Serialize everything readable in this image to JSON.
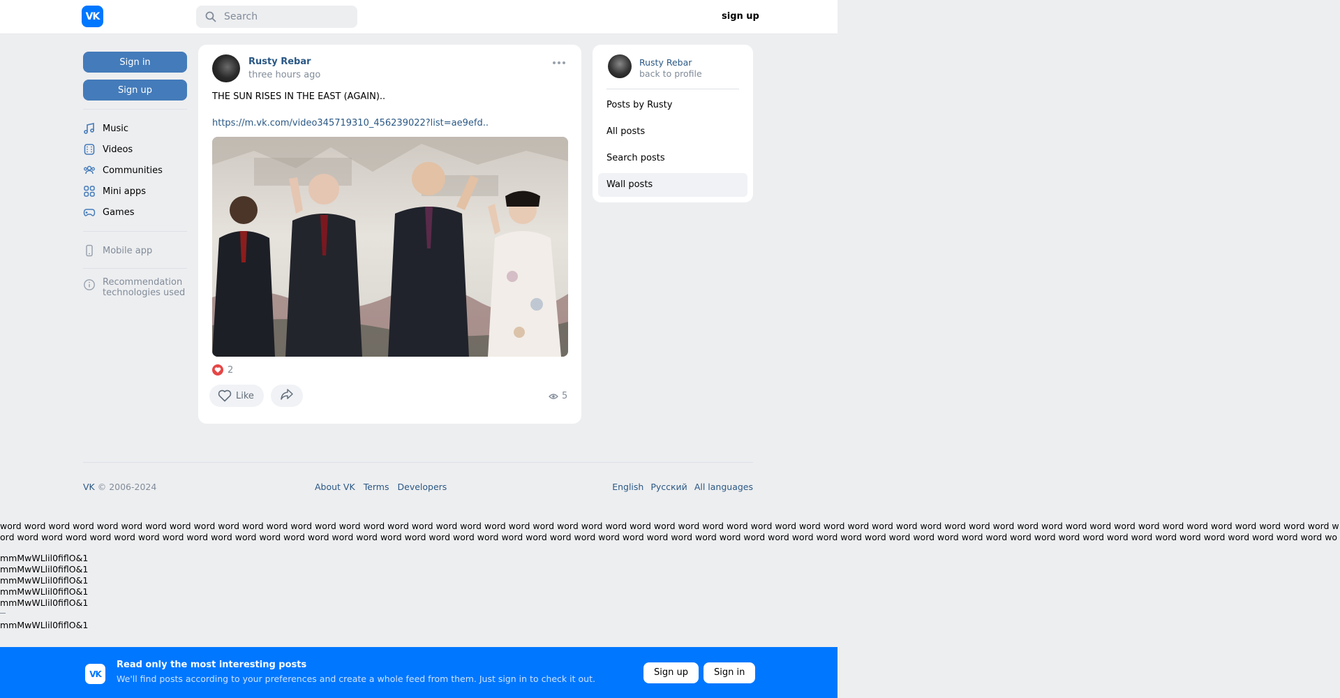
{
  "header": {
    "logo_text": "VK",
    "search_placeholder": "Search",
    "signup_label": "sign up"
  },
  "sidebar": {
    "signin_label": "Sign in",
    "signup_label": "Sign up",
    "items": [
      {
        "label": "Music",
        "icon": "music-icon"
      },
      {
        "label": "Videos",
        "icon": "video-icon"
      },
      {
        "label": "Communities",
        "icon": "communities-icon"
      },
      {
        "label": "Mini apps",
        "icon": "mini-apps-icon"
      },
      {
        "label": "Games",
        "icon": "games-icon"
      }
    ],
    "mobile_app": "Mobile app",
    "recommendation_line1": "Recommendation",
    "recommendation_line2": "technologies used"
  },
  "post": {
    "author": "Rusty Rebar",
    "time": "three hours ago",
    "text": "THE SUN RISES IN THE EAST (AGAIN)..",
    "link": "https://m.vk.com/video345719310_456239022?list=ae9efd..",
    "likes_count": "2",
    "like_label": "Like",
    "views_count": "5"
  },
  "right_menu": {
    "name": "Rusty Rebar",
    "back": "back to profile",
    "items": [
      "Posts by Rusty",
      "All posts",
      "Search posts",
      "Wall posts"
    ],
    "active_index": 3
  },
  "footer": {
    "copyright_vk": "VK",
    "copyright_rest": " © 2006-2024",
    "links": [
      "About VK",
      "Terms",
      "Developers"
    ],
    "langs": [
      "English",
      "Русский",
      "All languages"
    ]
  },
  "probe": {
    "words": "word word word word word word word word word word word word word word word word word word word word word word word word word word word word word word word word word word word word word word word word word word word word word word word word word word word word word word word word word word word word word word word word word word word word word word word word word word word word word word word word word word word word word word word word word word word word word word word word word word word word word word word word word word word word word word word word word word word word word word word word word word word word word word word word word word word word word word word word word word word word word word word word word word word word word word word word word word word word word word word word word word",
    "lines": [
      "mmMwWLlil0fiflO&1",
      "mmMwWLlil0fiflO&1",
      "mmMwWLlil0fiflO&1",
      "mmMwWLlil0fiflO&1",
      "mmMwWLlil0fiflO&1"
    ],
    "last_line": "mmMwWLlil0fiflO&1"
  },
  "banner": {
    "logo_text": "VK",
    "title": "Read only the most interesting posts",
    "subtitle": "We'll find posts according to your preferences and create a whole feed from them. Just sign in to check it out.",
    "signup_label": "Sign up",
    "signin_label": "Sign in"
  },
  "colors": {
    "brand_blue": "#0077ff",
    "link_blue": "#2a5885",
    "button_blue": "#447bba",
    "page_bg": "#edeef0"
  }
}
